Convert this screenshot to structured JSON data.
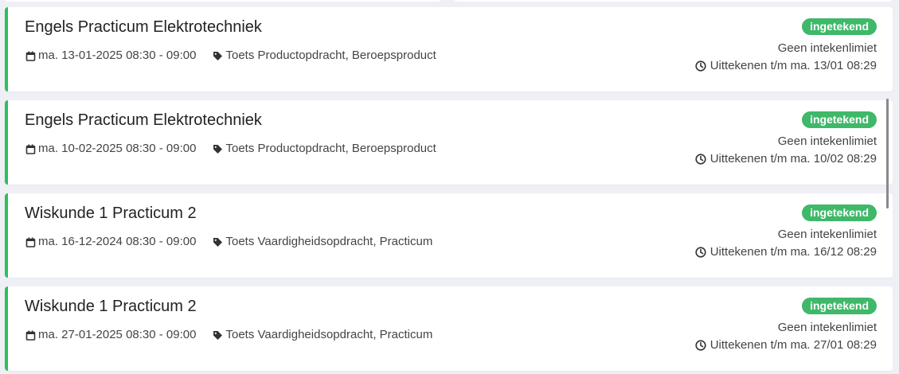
{
  "colors": {
    "accent_green": "#2ebf5a",
    "badge_green": "#3fb86a",
    "background": "#eef0f5"
  },
  "icons": {
    "date": "calendar-icon",
    "type": "tag-icon",
    "deadline": "clock-icon"
  },
  "cards": [
    {
      "title": "Engels Practicum Elektrotechniek",
      "date": "ma. 13-01-2025 08:30 - 09:00",
      "tags": "Toets Productopdracht, Beroepsproduct",
      "status": "ingetekend",
      "limit": "Geen intekenlimiet",
      "deadline": "Uittekenen t/m ma. 13/01 08:29"
    },
    {
      "title": "Engels Practicum Elektrotechniek",
      "date": "ma. 10-02-2025 08:30 - 09:00",
      "tags": "Toets Productopdracht, Beroepsproduct",
      "status": "ingetekend",
      "limit": "Geen intekenlimiet",
      "deadline": "Uittekenen t/m ma. 10/02 08:29"
    },
    {
      "title": "Wiskunde 1 Practicum 2",
      "date": "ma. 16-12-2024 08:30 - 09:00",
      "tags": "Toets Vaardigheidsopdracht, Practicum",
      "status": "ingetekend",
      "limit": "Geen intekenlimiet",
      "deadline": "Uittekenen t/m ma. 16/12 08:29"
    },
    {
      "title": "Wiskunde 1 Practicum 2",
      "date": "ma. 27-01-2025 08:30 - 09:00",
      "tags": "Toets Vaardigheidsopdracht, Practicum",
      "status": "ingetekend",
      "limit": "Geen intekenlimiet",
      "deadline": "Uittekenen t/m ma. 27/01 08:29"
    }
  ]
}
